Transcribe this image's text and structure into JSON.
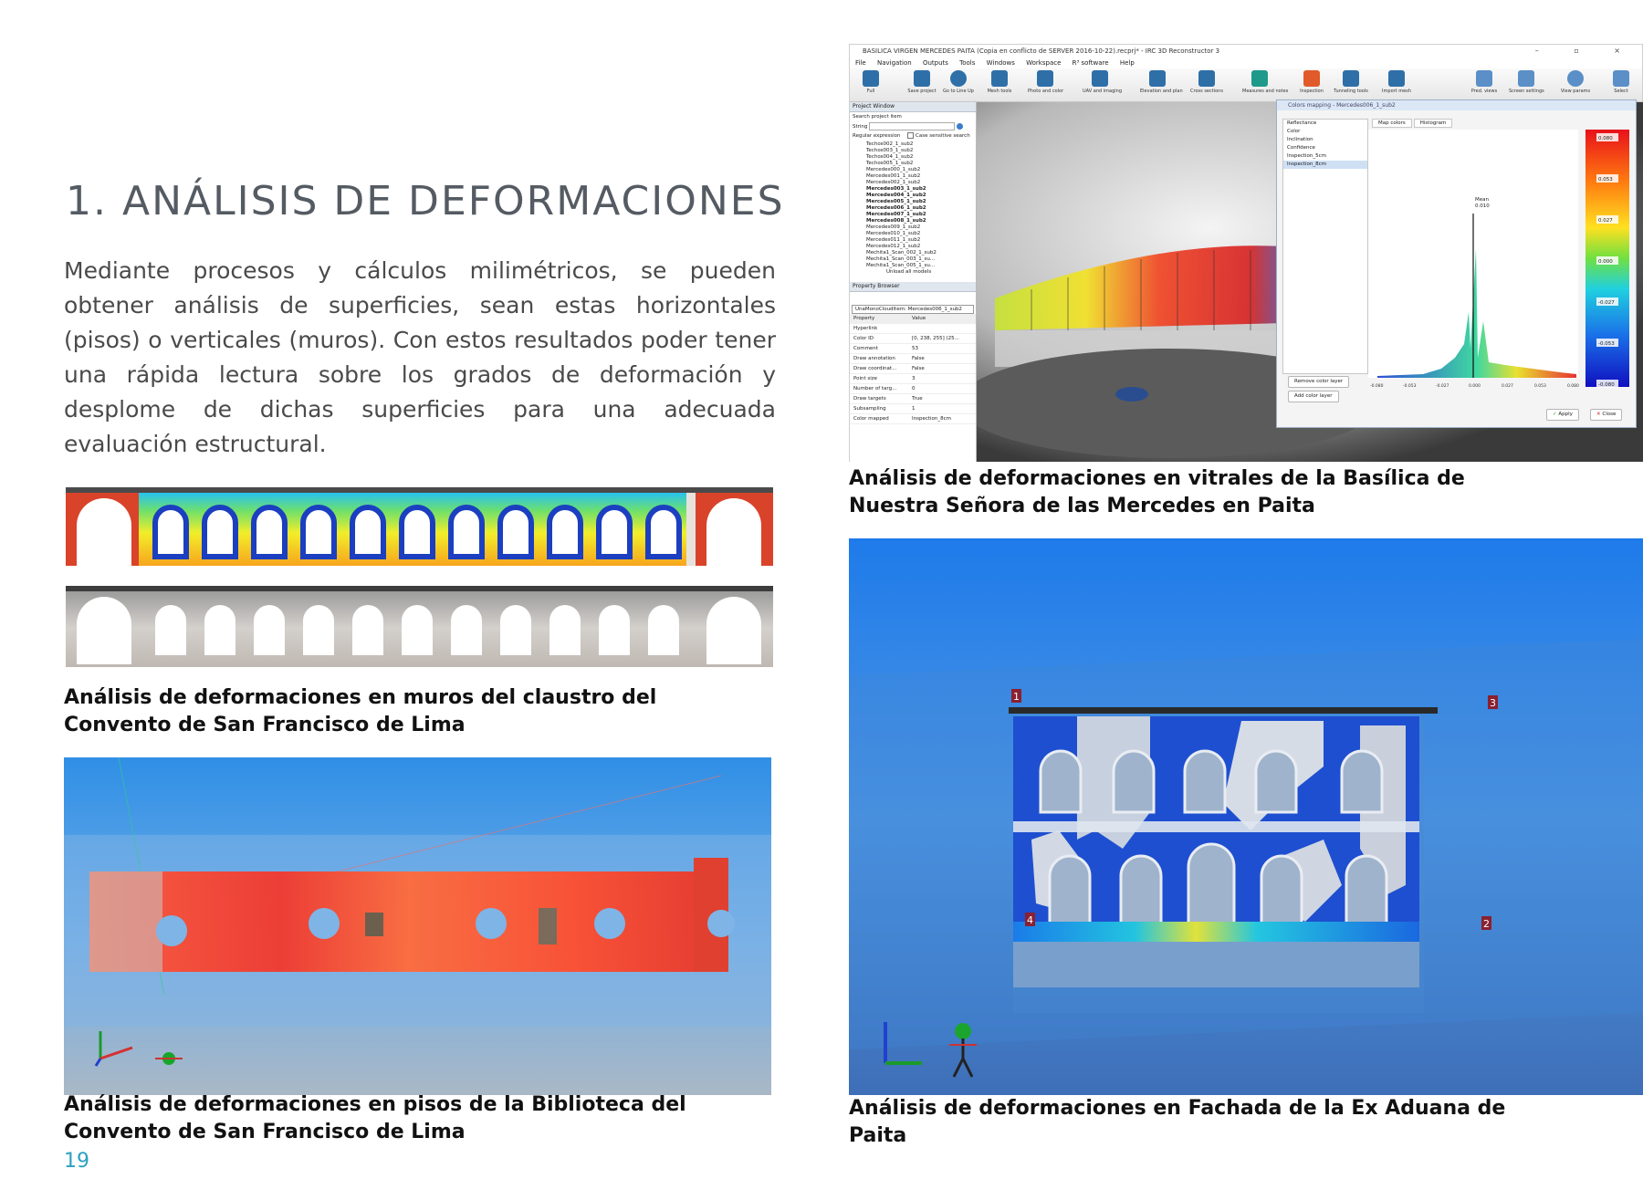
{
  "page": {
    "title": "1. ANÁLISIS DE DEFORMACIONES",
    "intro": "Mediante procesos y cálculos milimétricos, se pueden obtener análisis de superficies, sean estas horizontales (pisos) o vertica­les (muros). Con estos resultados poder tener una rápida lectura sobre los grados de deformación y desplome de dichas superfi­cies para una adecuada evaluación estructural.",
    "page_number": "19"
  },
  "captions": {
    "cloister": "Análisis de deformaciones en muros del claustro del Convento de San Francisco de Lima",
    "library": "Análisis de deformaciones en pisos de la Biblioteca  del Convento de San Francisco de Lima",
    "basilica": "Análisis de deformaciones en vitrales de la Basílica de Nuestra Señora de las Mercedes en Paita",
    "aduana": "Análisis de deformaciones en Fachada de la Ex Aduana de Paita"
  },
  "software": {
    "window_title": "BASILICA VIRGEN MERCEDES PAITA (Copia en conflicto de SERVER 2016-10-22).recprj* - IRC 3D Reconstructor 3",
    "window_controls": "– ▫ ×",
    "menu": [
      "File",
      "Navigation",
      "Outputs",
      "Tools",
      "Windows",
      "Workspace",
      "R³ software",
      "Help"
    ],
    "toolbar": [
      "Full",
      "Save project",
      "Go to Line Up",
      "Mesh tools",
      "Photo and color",
      "UAV and imaging",
      "Elevation and plan",
      "Cross sections",
      "Measures and notes",
      "Inspection",
      "Tunneling tools",
      "Import mesh",
      "Pred. views",
      "Screen settings",
      "View params",
      "Select"
    ],
    "project_window": {
      "header": "Project Window",
      "search_label": "Search project item",
      "string_label": "String",
      "regex_label": "Regular expression",
      "case_label": "Case sensitive search",
      "items": [
        "Techos002_1_sub2",
        "Techos003_1_sub2",
        "Techos004_1_sub2",
        "Techos005_1_sub2",
        "Mercedes000_1_sub2",
        "Mercedes001_1_sub2",
        "Mercedes002_1_sub2",
        "Mercedes003_1_sub2",
        "Mercedes004_1_sub2",
        "Mercedes005_1_sub2",
        "Mercedes006_1_sub2",
        "Mercedes007_1_sub2",
        "Mercedes008_1_sub2",
        "Mercedes009_1_sub2",
        "Mercedes010_1_sub2",
        "Mercedes011_1_sub2",
        "Mercedes012_1_sub2",
        "Mechita1_Scan_002_1_sub2",
        "Mechita1_Scan_003_1_su...",
        "Mechita1_Scan_005_1_su..."
      ],
      "bold_items": [
        7,
        8,
        9,
        10,
        11,
        12
      ],
      "footer": "Unload all models"
    },
    "property_browser": {
      "header": "Property Browser",
      "selected": "UnaMonoCloudItem: Mercedes006_1_sub2",
      "col_property": "Property",
      "col_value": "Value",
      "rows": [
        {
          "k": "Hyperlink",
          "v": ""
        },
        {
          "k": "Color ID",
          "v": "[0, 238, 255] (25..."
        },
        {
          "k": "Comment",
          "v": "53"
        },
        {
          "k": "Draw annotation",
          "v": "False"
        },
        {
          "k": "Draw coordinat...",
          "v": "False"
        },
        {
          "k": "Point size",
          "v": "3"
        },
        {
          "k": "Number of targ...",
          "v": "0"
        },
        {
          "k": "Draw targets",
          "v": "True"
        },
        {
          "k": "Subsampling",
          "v": "1"
        },
        {
          "k": "Color mapped",
          "v": "Inspection_8cm"
        }
      ]
    },
    "color_dialog": {
      "title": "Colors mapping - Mercedes006_1_sub2",
      "layers": [
        "Reflectance",
        "Color",
        "Inclination",
        "Confidence",
        "Inspection_5cm",
        "Inspection_8cm"
      ],
      "selected_layer": "Inspection_8cm",
      "tabs": [
        "Map colors",
        "Histogram"
      ],
      "mean_label": "Mean",
      "mean_value": "0.010",
      "scale_labels": [
        "0.080",
        "0.053",
        "0.027",
        "0.000",
        "-0.027",
        "-0.053",
        "-0.080"
      ],
      "axis_ticks": [
        "-0.080",
        "-0.053",
        "-0.027",
        "0.000",
        "0.027",
        "0.053",
        "0.080"
      ],
      "remove_layer": "Remove color layer",
      "add_layer": "Add color layer",
      "apply": "Apply",
      "close": "Close"
    }
  },
  "aduana_markers": [
    "1",
    "2",
    "3",
    "4"
  ]
}
